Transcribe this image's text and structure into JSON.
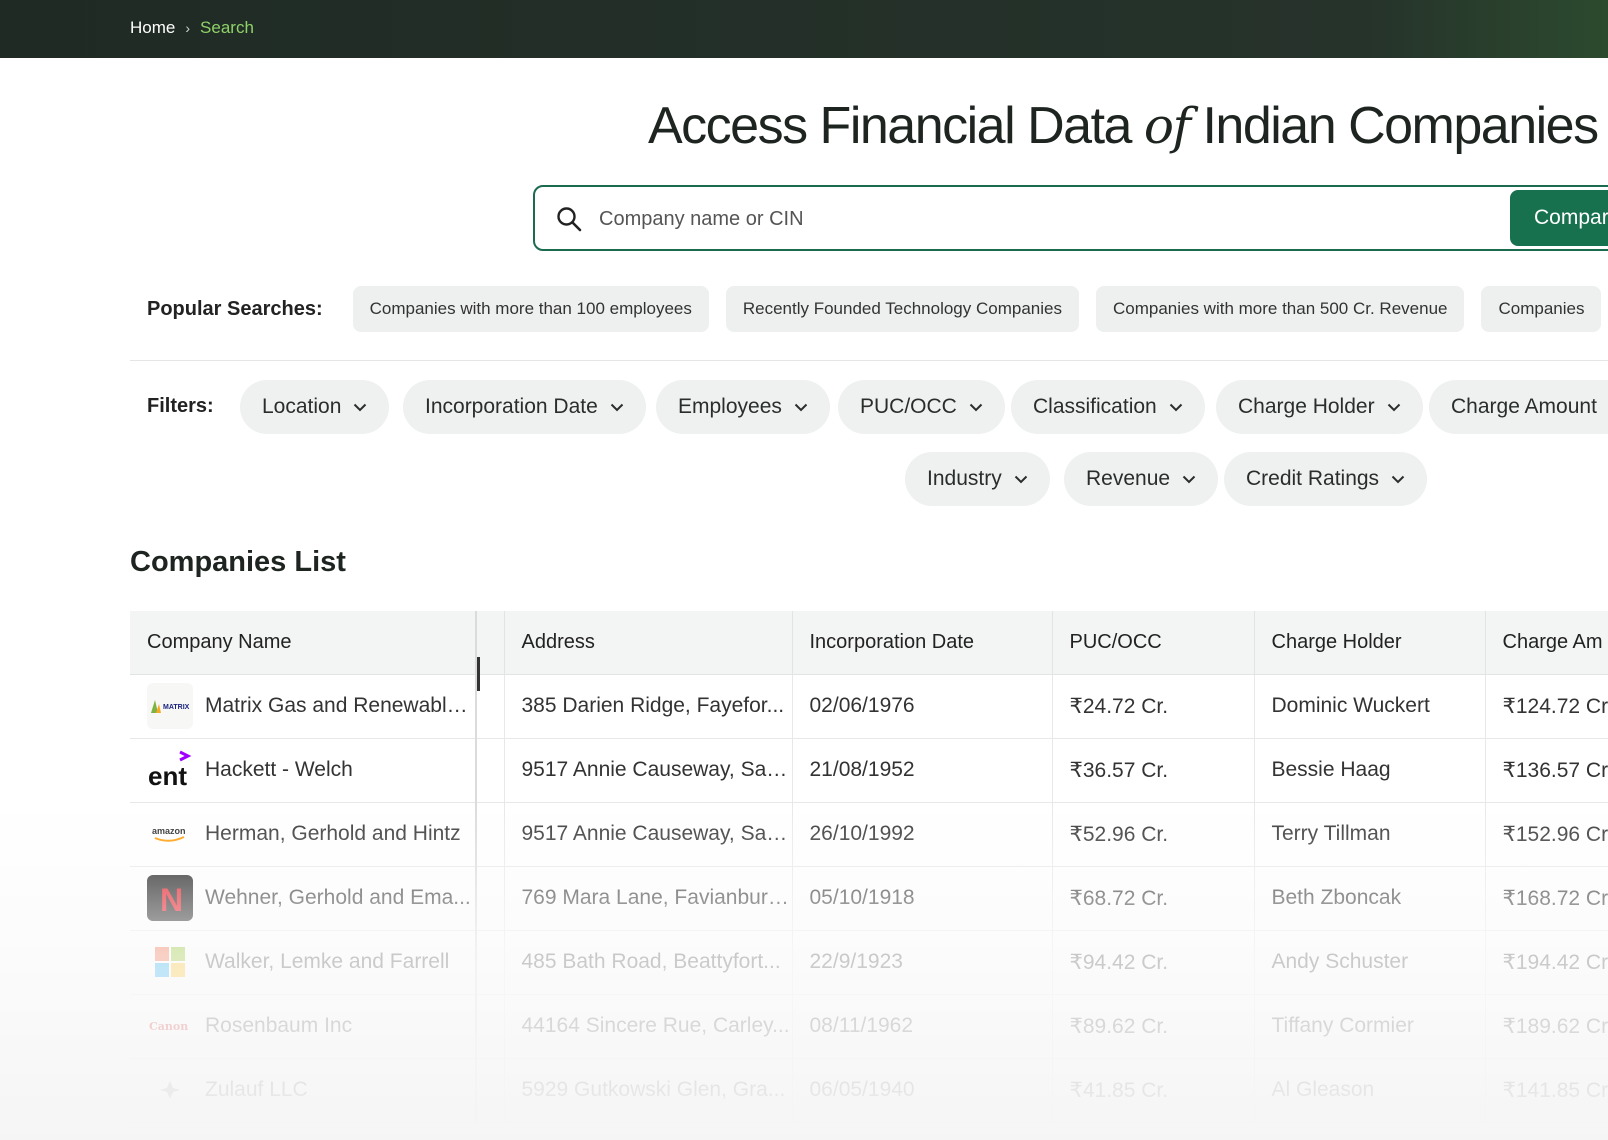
{
  "breadcrumb": {
    "home": "Home",
    "separator": "›",
    "current": "Search"
  },
  "hero": {
    "title_part1": "Access Financial Data ",
    "title_of": "of",
    "title_part2": "Indian Companies"
  },
  "search": {
    "placeholder": "Company name or CIN",
    "value": "",
    "button_label": "Compar",
    "icon": "search-icon"
  },
  "popular": {
    "label": "Popular Searches:",
    "chips": [
      "Companies with more than 100 employees",
      "Recently Founded Technology Companies",
      "Companies with more than 500 Cr. Revenue",
      "Companies"
    ]
  },
  "filters": {
    "label": "Filters:",
    "items": [
      "Location",
      "Incorporation Date",
      "Employees",
      "PUC/OCC",
      "Classification",
      "Charge Holder",
      "Charge Amount",
      "Industry",
      "Revenue",
      "Credit Ratings"
    ]
  },
  "companies": {
    "title": "Companies List",
    "columns": [
      "Company Name",
      "Address",
      "Incorporation Date",
      "PUC/OCC",
      "Charge Holder",
      "Charge Am"
    ],
    "rows": [
      {
        "logo": "MATRIX",
        "name": "Matrix Gas and Renewable...",
        "address": "385 Darien Ridge, Fayefor...",
        "date": "02/06/1976",
        "puc": "₹24.72 Cr.",
        "holder": "Dominic Wuckert",
        "amount": "₹124.72 Cr."
      },
      {
        "logo": "ent",
        "name": "Hackett - Welch",
        "address": "9517 Annie Causeway, Saw...",
        "date": "21/08/1952",
        "puc": "₹36.57 Cr.",
        "holder": "Bessie Haag",
        "amount": "₹136.57 Cr."
      },
      {
        "logo": "amazon",
        "name": "Herman, Gerhold and Hintz",
        "address": "9517 Annie Causeway, Saw...",
        "date": "26/10/1992",
        "puc": "₹52.96 Cr.",
        "holder": "Terry Tillman",
        "amount": "₹152.96 Cr."
      },
      {
        "logo": "N",
        "name": "Wehner, Gerhold and Ema...",
        "address": "769 Mara Lane, Favianbury...",
        "date": "05/10/1918",
        "puc": "₹68.72 Cr.",
        "holder": "Beth Zboncak",
        "amount": "₹168.72 Cr."
      },
      {
        "logo": "",
        "name": "Walker, Lemke and Farrell",
        "address": "485 Bath Road, Beattyfort...",
        "date": "22/9/1923",
        "puc": "₹94.42 Cr.",
        "holder": "Andy Schuster",
        "amount": "₹194.42 Cr."
      },
      {
        "logo": "Canon",
        "name": "Rosenbaum Inc",
        "address": "44164 Sincere Rue, Carley...",
        "date": "08/11/1962",
        "puc": "₹89.62 Cr.",
        "holder": "Tiffany Cormier",
        "amount": "₹189.62 Cr."
      },
      {
        "logo": "",
        "name": "Zulauf LLC",
        "address": "5929 Gutkowski Glen, Gra...",
        "date": "06/05/1940",
        "puc": "₹41.85 Cr.",
        "holder": "Al Gleason",
        "amount": "₹141.85 Cr."
      }
    ]
  },
  "colors": {
    "topbar": "#1f2a24",
    "breadcrumb_active": "#8fd169",
    "accent": "#17714f",
    "chip_bg": "#eef0ef",
    "pill_bg": "#eef1f0"
  }
}
